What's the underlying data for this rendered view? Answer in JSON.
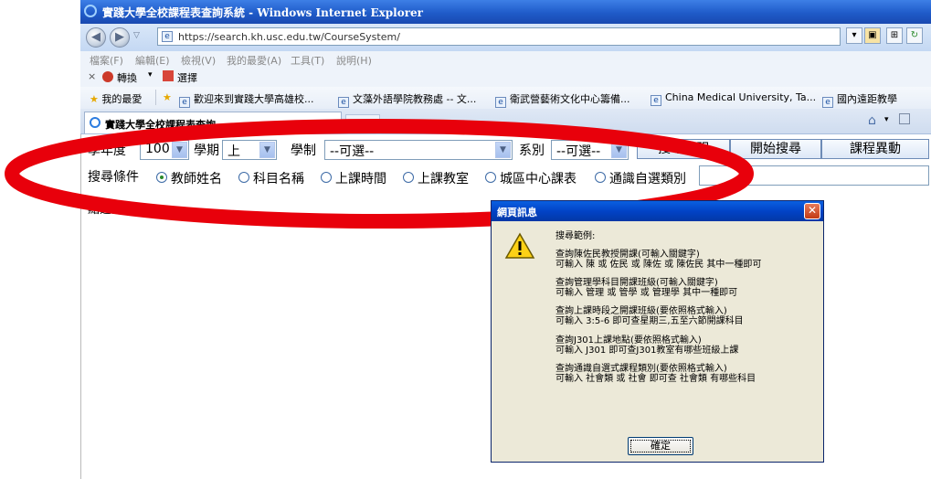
{
  "window": {
    "title": "實踐大學全校課程表查詢系統 - Windows Internet Explorer",
    "url": "https://search.kh.usc.edu.tw/CourseSystem/"
  },
  "menu": [
    "檔案(F)",
    "編輯(E)",
    "檢視(V)",
    "我的最愛(A)",
    "工具(T)",
    "說明(H)"
  ],
  "toolbar": {
    "close": "×",
    "convert": "轉換",
    "select": "選擇"
  },
  "favorites": {
    "label": "我的最愛",
    "items": [
      "歡迎來到實踐大學高雄校...",
      "文藻外語學院教務處 -- 文...",
      "衛武營藝術文化中心籌備...",
      "China Medical University, Ta...",
      "國內遠距教學"
    ]
  },
  "tab": {
    "title": "實踐大學全校課程表查詢..."
  },
  "form": {
    "year_label": "學年度",
    "year_value": "100",
    "term_label": "學期",
    "term_value": "上",
    "system_label": "學制",
    "system_value": "--可選--",
    "dept_label": "系別",
    "dept_value": "--可選--",
    "btn_help": "搜尋說明",
    "btn_search": "開始搜尋",
    "btn_change": "課程異動",
    "criteria_label": "搜尋條件",
    "options": [
      "教師姓名",
      "科目名稱",
      "上課時間",
      "上課教室",
      "城區中心課表",
      "通識自選類別"
    ],
    "selected_option": "教師姓名",
    "selected_note": "點選課程"
  },
  "dialog": {
    "title": "網頁訊息",
    "heading": "搜尋範例:",
    "lines": [
      "查詢陳佐民教授開課(可輸入關鍵字)",
      "可輸入 陳 或 佐民 或 陳佐 或 陳佐民 其中一種即可",
      "查詢管理學科目開課班級(可輸入關鍵字)",
      "可輸入 管理 或 管學 或 管理學 其中一種即可",
      "查詢上課時段之開課班級(要依照格式輸入)",
      "可輸入 3:5-6 即可查星期三,五至六節開課科目",
      "查詢J301上課地點(要依照格式輸入)",
      "可輸入 J301 即可查J301教室有哪些班級上課",
      "查詢通識自選式課程類別(要依照格式輸入)",
      "可輸入 社會類 或 社會 即可查 社會類 有哪些科目"
    ],
    "ok": "確定"
  },
  "colors": {
    "annotation": "#e8000b",
    "title_bar": "#1f5bc9",
    "dialog_bg": "#ece9d8"
  }
}
